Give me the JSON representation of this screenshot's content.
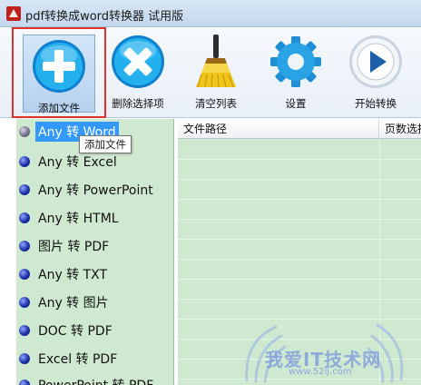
{
  "window": {
    "title": "pdf转换成word转换器 试用版"
  },
  "toolbar": {
    "add_file": "添加文件",
    "remove_selected": "删除选择项",
    "clear_list": "清空列表",
    "settings": "设置",
    "start_convert": "开始转换"
  },
  "tooltip": "添加文件",
  "categories": [
    "Any 转 Word",
    "Any 转 Excel",
    "Any 转 PowerPoint",
    "Any 转 HTML",
    "图片 转 PDF",
    "Any 转 TXT",
    "Any 转 图片",
    "DOC 转 PDF",
    "Excel 转 PDF",
    "PowerPoint 转 PDF"
  ],
  "selected_category_index": 0,
  "table": {
    "columns": [
      "文件路径",
      "页数选择"
    ]
  },
  "watermark": {
    "text": "我爱IT技术网",
    "url": "www.52ij.com"
  },
  "colors": {
    "panel_green": "#cfe9d1",
    "selection_blue": "#3399ff",
    "highlight_red": "#e0312b",
    "add_icon_blue": "#1aa3e8",
    "remove_icon_blue": "#1aa3e8",
    "broom_yellow": "#f0c419",
    "gear_blue": "#29a3e6"
  }
}
